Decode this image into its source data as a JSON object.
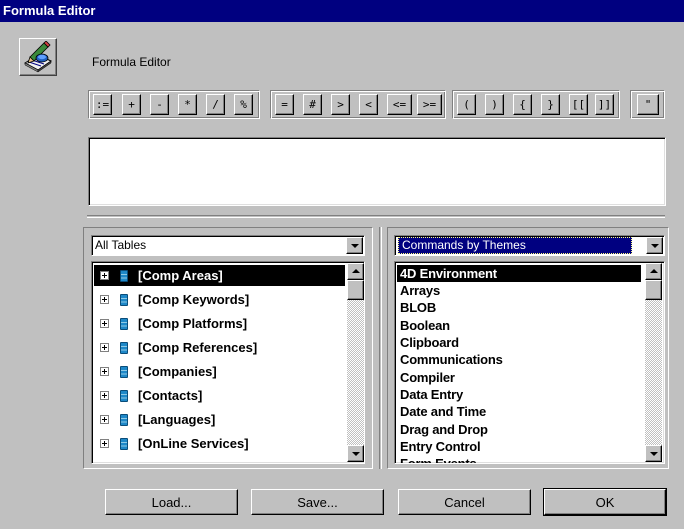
{
  "window": {
    "title": "Formula Editor"
  },
  "heading": "Formula Editor",
  "operators": [
    ":=",
    "+",
    "-",
    "*",
    "/",
    "%",
    "=",
    "#",
    ">",
    "<",
    "<=",
    ">=",
    "(",
    ")",
    "{",
    "}",
    "[[",
    "]]",
    "\""
  ],
  "tables_dropdown": {
    "value": "All Tables"
  },
  "tables": [
    "[Comp Areas]",
    "[Comp Keywords]",
    "[Comp Platforms]",
    "[Comp References]",
    "[Companies]",
    "[Contacts]",
    "[Languages]",
    "[OnLine Services]"
  ],
  "selected_table": "[Comp Areas]",
  "commands_dropdown": {
    "value": "Commands by Themes"
  },
  "commands": [
    "4D Environment",
    "Arrays",
    "BLOB",
    "Boolean",
    "Clipboard",
    "Communications",
    "Compiler",
    "Data Entry",
    "Date and Time",
    "Drag and Drop",
    "Entry Control",
    "Form Events"
  ],
  "selected_command": "4D Environment",
  "buttons": {
    "load": "Load...",
    "save": "Save...",
    "cancel": "Cancel",
    "ok": "OK"
  },
  "icons": {
    "app": "formula-editor-icon",
    "table": "table-icon",
    "expand": "expand-icon"
  }
}
